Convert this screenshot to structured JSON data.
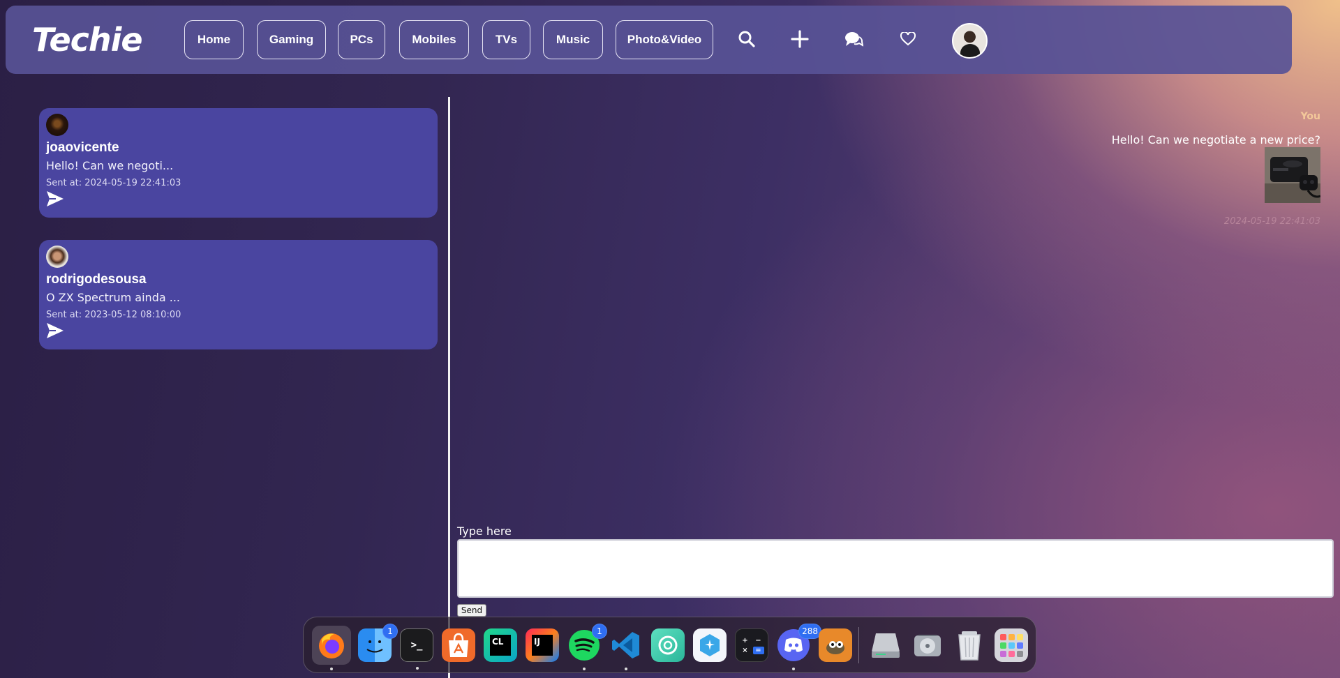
{
  "navbar": {
    "logo": "Techie",
    "links": [
      "Home",
      "Gaming",
      "PCs",
      "Mobiles",
      "TVs",
      "Music",
      "Photo&Video"
    ],
    "icons": [
      "search-icon",
      "plus-icon",
      "chat-icon",
      "heart-icon"
    ]
  },
  "conversations": [
    {
      "username": "joaovicente",
      "preview": "Hello! Can we negoti...",
      "sent_at": "Sent at: 2024-05-19 22:41:03"
    },
    {
      "username": "rodrigodesousa",
      "preview": "O ZX Spectrum ainda ...",
      "sent_at": "Sent at: 2023-05-12 08:10:00"
    }
  ],
  "chat": {
    "message": {
      "author": "You",
      "text": "Hello! Can we negotiate a new price?",
      "timestamp": "2024-05-19 22:41:03"
    },
    "input_label": "Type here",
    "input_value": "",
    "send_label": "Send"
  },
  "dock": {
    "apps": [
      {
        "name": "firefox",
        "badge": ""
      },
      {
        "name": "finder",
        "badge": "1"
      },
      {
        "name": "terminal",
        "badge": ""
      },
      {
        "name": "app-store",
        "badge": ""
      },
      {
        "name": "clion",
        "badge": ""
      },
      {
        "name": "intellij-idea",
        "badge": ""
      },
      {
        "name": "spotify",
        "badge": "1"
      },
      {
        "name": "vscode",
        "badge": ""
      },
      {
        "name": "lens",
        "badge": ""
      },
      {
        "name": "hex-app",
        "badge": ""
      },
      {
        "name": "calculator",
        "badge": ""
      },
      {
        "name": "discord",
        "badge": "288"
      },
      {
        "name": "gimp",
        "badge": ""
      },
      {
        "name": "external-drive",
        "badge": ""
      },
      {
        "name": "disk-utility",
        "badge": ""
      },
      {
        "name": "trash",
        "badge": ""
      },
      {
        "name": "launchpad",
        "badge": ""
      }
    ]
  },
  "colors": {
    "navbar_bg": "#58529a",
    "card_bg": "#4a45a0",
    "author_accent": "#f3c89a",
    "timestamp_accent": "#b7849a",
    "badge_blue": "#2f6ef2"
  }
}
